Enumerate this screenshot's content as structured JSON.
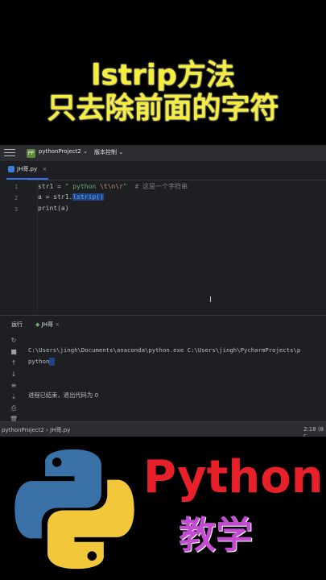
{
  "banner": {
    "line1": "lstrip方法",
    "line2": "只去除前面的字符"
  },
  "topbar": {
    "project_badge": "PP",
    "project_name": "pythonProject2",
    "vcs_label": "版本控制"
  },
  "editor": {
    "tab_name": "JH哥.py",
    "line_numbers": [
      "1",
      "2",
      "3"
    ],
    "lines": [
      {
        "a": "str1 = ",
        "b": "\" python ",
        "c": "\\t\\n\\r",
        "d": "\"",
        "e": "  # 这是一个字符串"
      },
      {
        "a": "a = str1.",
        "sel": "lstrip()"
      },
      {
        "a": "print(a)"
      }
    ]
  },
  "run_panel": {
    "run_label": "运行",
    "tab_name": "JH哥",
    "command": "C:\\Users\\jingh\\Documents\\anaconda\\python.exe C:\\Users\\jingh\\PycharmProjects\\p",
    "output": "python",
    "exit_message": "进程已结束，退出代码为 0"
  },
  "status_bar": {
    "path": "pythonProject2 › JH哥.py",
    "position": "2:18 (8 c"
  },
  "promo": {
    "word": "Python",
    "subtitle": "教学"
  },
  "colors": {
    "banner_text": "#f5ef3c",
    "python_red": "#e8202a",
    "subtitle_purple": "#c24bd1",
    "logo_blue": "#3a72a8",
    "logo_yellow": "#f2c83a"
  }
}
